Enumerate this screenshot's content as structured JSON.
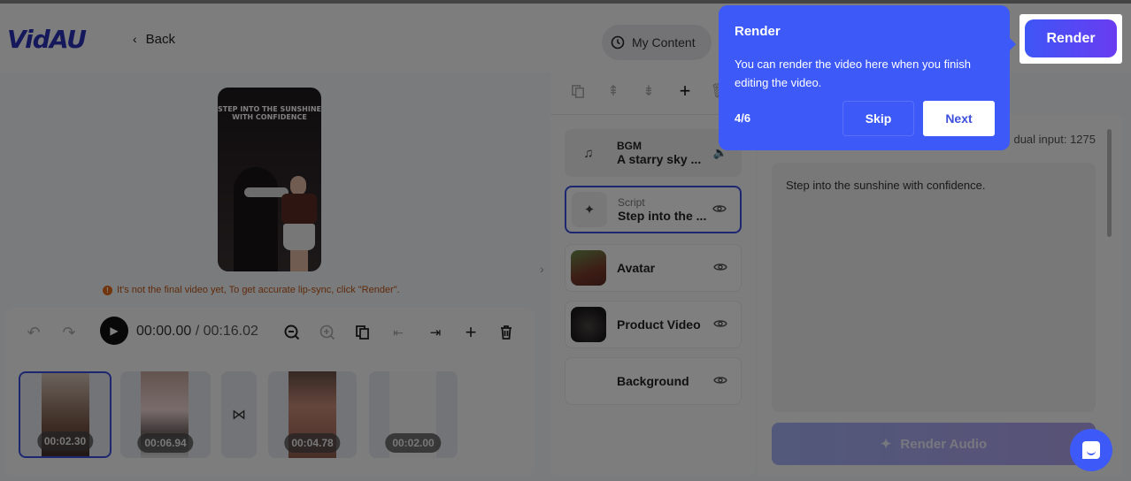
{
  "app": {
    "logo": "VidAU",
    "back_label": "Back",
    "my_content_label": "My Content",
    "render_label": "Render"
  },
  "preview": {
    "caption_line1": "STEP INTO THE SUNSHINE",
    "caption_line2": "WITH CONFIDENCE",
    "warning": "It's not the final video yet, To get accurate lip-sync, click \"Render\"."
  },
  "timeline": {
    "current_time": "00:00.00",
    "separator": " / ",
    "total_time": "00:16.02",
    "clips": [
      {
        "duration": "00:02.30",
        "selected": true
      },
      {
        "duration": "00:06.94",
        "selected": false
      },
      {
        "duration": "00:04.78",
        "selected": false
      },
      {
        "duration": "00:02.00",
        "selected": false
      }
    ],
    "transition_icon": "transition-icon"
  },
  "layers": {
    "items": [
      {
        "type_label": "BGM",
        "name": "A starry sky ...",
        "icon": "music-note-icon",
        "action_icon": "volume-icon"
      },
      {
        "type_label": "Script",
        "name": "Step into the ...",
        "icon": "script-sparkle-icon",
        "action_icon": "eye-icon"
      },
      {
        "name": "Avatar",
        "icon": "avatar-thumbnail",
        "action_icon": "eye-icon"
      },
      {
        "name": "Product Video",
        "icon": "product-video-thumbnail",
        "action_icon": "eye-icon"
      },
      {
        "name": "Background",
        "action_icon": "eye-icon"
      }
    ]
  },
  "script_panel": {
    "residual_input": "dual input: 1275",
    "script_text": "Step into the sunshine with confidence.",
    "render_audio_label": "Render Audio"
  },
  "tour": {
    "title": "Render",
    "body": "You can render the video here when you finish editing the video.",
    "step": "4/6",
    "skip_label": "Skip",
    "next_label": "Next"
  },
  "colors": {
    "brand": "#2b33b8",
    "accent": "#3d59f7",
    "warning": "#e36a1d"
  }
}
